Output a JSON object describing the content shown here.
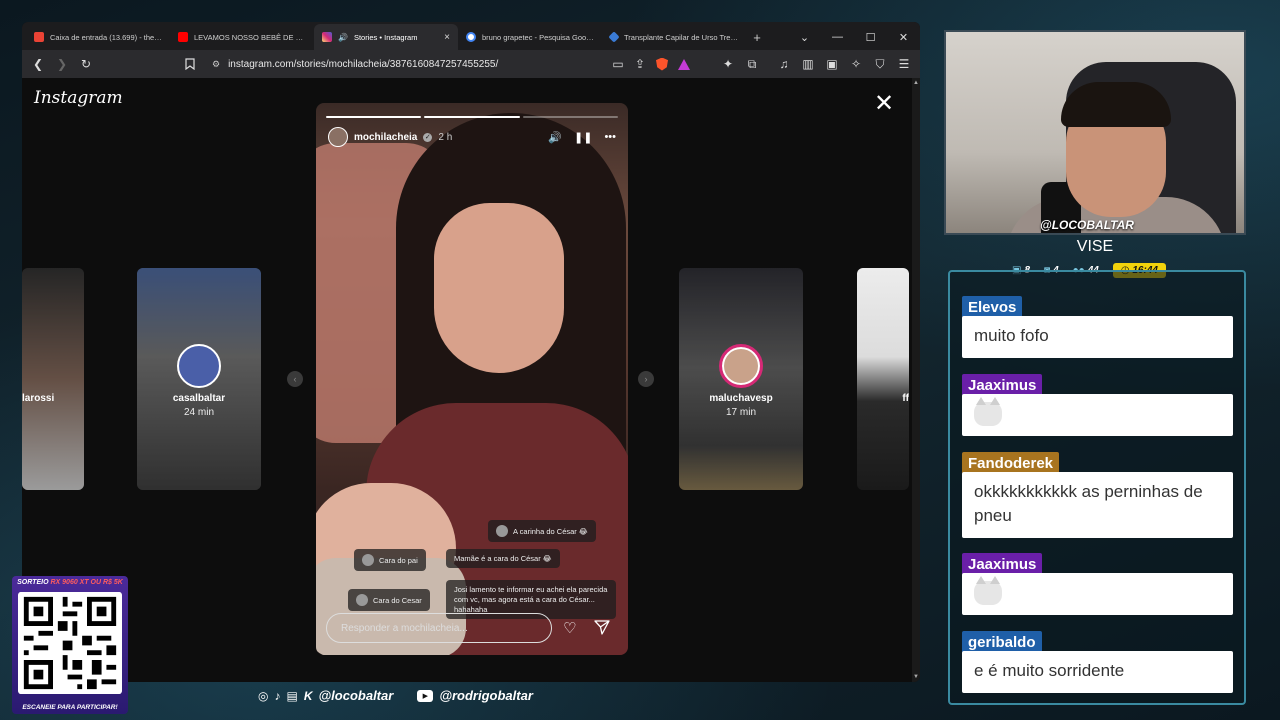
{
  "browser": {
    "tabs": [
      {
        "title": "Caixa de entrada (13.699) - thebalt",
        "favicon": "gmail-icon",
        "color": "#ea4335",
        "active": false
      },
      {
        "title": "LEVAMOS NOSSO BEBÊ DE 5 MESE",
        "favicon": "youtube-icon",
        "color": "#ff0000",
        "active": false
      },
      {
        "title": "Stories • Instagram",
        "favicon": "instagram-icon",
        "color": "#d62976",
        "active": true,
        "close": "×"
      },
      {
        "title": "bruno grapetec - Pesquisa Google",
        "favicon": "google-icon",
        "color": "#4285f4",
        "active": false
      },
      {
        "title": "Transplante Capilar de Urso Trevo",
        "favicon": "bing-icon",
        "color": "#3a7bd5",
        "active": false
      }
    ],
    "new_tab": "+",
    "window_controls": {
      "dropdown": "⌄",
      "minimize": "—",
      "maximize": "☐",
      "close": "✕"
    },
    "nav": {
      "back": "❮",
      "forward": "❯",
      "reload": "↻",
      "bookmark": "🔖"
    },
    "url": "instagram.com/stories/mochilacheia/3876160847257455255/"
  },
  "instagram": {
    "logo": "Instagram",
    "close": "✕",
    "prev_arrow": "‹",
    "next_arrow": "›",
    "thumbs": [
      {
        "username": "larossi",
        "time": ""
      },
      {
        "username": "casalbaltar",
        "time": "24 min"
      },
      {
        "username": "maluchavesp",
        "time": "17 min"
      },
      {
        "username": "ff",
        "time": ""
      }
    ],
    "story": {
      "username": "mochilacheia",
      "time": "2 h",
      "verified": "✓",
      "sound": "🔊",
      "pause": "❚❚",
      "more": "•••",
      "bubbles": [
        {
          "text": "A carinha do César 😂"
        },
        {
          "text": "Cara do pai"
        },
        {
          "text": "Mamãe é a cara do César 😂"
        },
        {
          "text": "Cara do Cesar"
        },
        {
          "text": "Josi lamento te informar eu achei ela parecida com vc, mas agora está a cara do César... hahahaha"
        }
      ],
      "reply_placeholder": "Responder a mochilacheia...",
      "heart": "♡"
    }
  },
  "stream": {
    "handle": "@LOCOBALTAR",
    "name": "VISE",
    "stats": {
      "chat": "8",
      "video": "4",
      "viewers": "44",
      "clock": "16:44"
    },
    "chat": [
      {
        "user": "Elevos",
        "text": "muito fofo",
        "color": "#1f5fa8"
      },
      {
        "user": "Jaaximus",
        "text": "",
        "emote": "cat-emote",
        "color": "#6a1fa8"
      },
      {
        "user": "Fandoderek",
        "text": "okkkkkkkkkkk as perninhas de pneu",
        "color": "#a8741f"
      },
      {
        "user": "Jaaximus",
        "text": "",
        "emote": "cat-emote",
        "color": "#6a1fa8"
      },
      {
        "user": "geribaldo",
        "text": "e é muito sorridente",
        "color": "#1f5fa8"
      }
    ],
    "qr_top": "SORTEIO",
    "qr_top_highlight": "RX 9060 XT OU R$ 5K",
    "qr_bottom": "ESCANEIE PARA PARTICIPAR!",
    "socials": {
      "handle1": "@locobaltar",
      "handle2": "@rodrigobaltar"
    }
  }
}
